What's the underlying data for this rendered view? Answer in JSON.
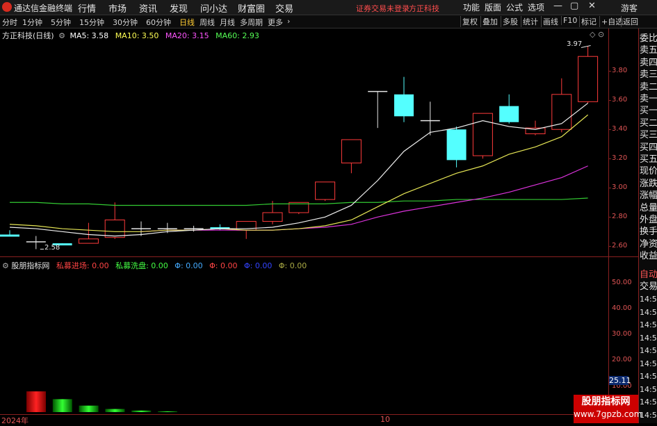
{
  "app": {
    "title": "通达信金融终端",
    "menu": [
      "行情",
      "市场",
      "资讯",
      "发现",
      "问小达",
      "财富圈",
      "交易"
    ],
    "status": "证券交易未登录",
    "stock_name": "方正科技",
    "top_right": [
      "功能",
      "版面",
      "公式",
      "选项"
    ],
    "guest": "游客"
  },
  "periods": [
    "分时",
    "1分钟",
    "5分钟",
    "15分钟",
    "30分钟",
    "60分钟",
    "日线",
    "周线",
    "月线",
    "多周期",
    "更多"
  ],
  "active_period": "日线",
  "tools": [
    "复权",
    "叠加",
    "多股",
    "统计",
    "画线",
    "F10",
    "标记",
    "+自选",
    "返回"
  ],
  "main_legend": {
    "title": "方正科技(日线)",
    "items": [
      {
        "label": "MA5: 3.58",
        "color": "#ffffff"
      },
      {
        "label": "MA10: 3.50",
        "color": "#ffff55"
      },
      {
        "label": "MA20: 3.15",
        "color": "#ff55ff"
      },
      {
        "label": "MA60: 2.93",
        "color": "#55ff55"
      }
    ]
  },
  "price_axis": [
    "3.80",
    "3.60",
    "3.40",
    "3.20",
    "3.00",
    "2.80",
    "2.60"
  ],
  "annotations": {
    "high": "3.97",
    "low": "2.58"
  },
  "indicator_legend": {
    "title": "股朋指标网",
    "items": [
      {
        "label": "私募进场: 0.00",
        "color": "#ff4444"
      },
      {
        "label": "私募洗盘: 0.00",
        "color": "#44ff44"
      },
      {
        "label": "Φ: 0.00",
        "color": "#44aaff"
      },
      {
        "label": "Φ: 0.00",
        "color": "#ff4444"
      },
      {
        "label": "Φ: 0.00",
        "color": "#3344ff"
      },
      {
        "label": "Φ: 0.00",
        "color": "#aaaa44"
      }
    ]
  },
  "indicator_axis": [
    "50.00",
    "40.00",
    "30.00",
    "20.00",
    "10.00"
  ],
  "indicator_current": "25.11",
  "date_labels": [
    "2024年",
    "10"
  ],
  "right_panel": {
    "quote_labels": [
      "委比",
      "卖五",
      "卖四",
      "卖三",
      "卖二",
      "卖一",
      "买一",
      "买二",
      "买三",
      "买四",
      "买五",
      "现价",
      "涨跌",
      "涨幅",
      "总量",
      "外盘",
      "换手",
      "净资",
      "收益"
    ],
    "mode_labels": [
      "自动",
      "交易"
    ],
    "times": [
      "14:56",
      "14:56",
      "14:56",
      "14:56",
      "14:56",
      "14:56",
      "14:56",
      "14:56",
      "14:56",
      "14:56"
    ]
  },
  "watermark": {
    "line1": "股朋指标网",
    "line2": "www.7gpzb.com"
  },
  "chart_data": {
    "type": "candlestick",
    "candles": [
      {
        "o": 2.68,
        "c": 2.68,
        "h": 2.71,
        "l": 2.68,
        "color": "cyan"
      },
      {
        "o": 2.63,
        "c": 2.63,
        "h": 2.67,
        "l": 2.58,
        "color": "white"
      },
      {
        "o": 2.61,
        "c": 2.62,
        "h": 2.62,
        "l": 2.61,
        "color": "cyan"
      },
      {
        "o": 2.62,
        "c": 2.65,
        "h": 2.76,
        "l": 2.62,
        "color": "red"
      },
      {
        "o": 2.66,
        "c": 2.78,
        "h": 2.9,
        "l": 2.65,
        "color": "red"
      },
      {
        "o": 2.72,
        "c": 2.72,
        "h": 2.77,
        "l": 2.67,
        "color": "white"
      },
      {
        "o": 2.72,
        "c": 2.72,
        "h": 2.76,
        "l": 2.69,
        "color": "white"
      },
      {
        "o": 2.72,
        "c": 2.72,
        "h": 2.74,
        "l": 2.7,
        "color": "white"
      },
      {
        "o": 2.73,
        "c": 2.72,
        "h": 2.75,
        "l": 2.71,
        "color": "cyan"
      },
      {
        "o": 2.71,
        "c": 2.77,
        "h": 2.77,
        "l": 2.65,
        "color": "red"
      },
      {
        "o": 2.77,
        "c": 2.83,
        "h": 2.91,
        "l": 2.75,
        "color": "red"
      },
      {
        "o": 2.83,
        "c": 2.9,
        "h": 2.9,
        "l": 2.82,
        "color": "red"
      },
      {
        "o": 2.92,
        "c": 3.04,
        "h": 3.04,
        "l": 2.91,
        "color": "red"
      },
      {
        "o": 3.17,
        "c": 3.33,
        "h": 3.33,
        "l": 3.1,
        "color": "red"
      },
      {
        "o": 3.66,
        "c": 3.66,
        "h": 3.66,
        "l": 3.41,
        "color": "white"
      },
      {
        "o": 3.64,
        "c": 3.49,
        "h": 3.76,
        "l": 3.45,
        "color": "cyan"
      },
      {
        "o": 3.46,
        "c": 3.46,
        "h": 3.59,
        "l": 3.36,
        "color": "white"
      },
      {
        "o": 3.4,
        "c": 3.19,
        "h": 3.42,
        "l": 3.14,
        "color": "cyan"
      },
      {
        "o": 3.22,
        "c": 3.51,
        "h": 3.51,
        "l": 3.2,
        "color": "red"
      },
      {
        "o": 3.56,
        "c": 3.45,
        "h": 3.64,
        "l": 3.44,
        "color": "cyan"
      },
      {
        "o": 3.37,
        "c": 3.41,
        "h": 3.46,
        "l": 3.36,
        "color": "red"
      },
      {
        "o": 3.4,
        "c": 3.64,
        "h": 3.75,
        "l": 3.38,
        "color": "red"
      },
      {
        "o": 3.59,
        "c": 3.9,
        "h": 3.97,
        "l": 3.58,
        "color": "red"
      }
    ],
    "ma5": [
      2.73,
      2.72,
      2.7,
      2.68,
      2.67,
      2.68,
      2.7,
      2.71,
      2.72,
      2.72,
      2.73,
      2.76,
      2.8,
      2.88,
      3.05,
      3.25,
      3.38,
      3.41,
      3.46,
      3.42,
      3.4,
      3.44,
      3.58
    ],
    "ma10": [
      2.75,
      2.74,
      2.72,
      2.71,
      2.7,
      2.7,
      2.71,
      2.71,
      2.72,
      2.71,
      2.71,
      2.72,
      2.74,
      2.78,
      2.87,
      2.96,
      3.03,
      3.1,
      3.15,
      3.23,
      3.28,
      3.35,
      3.5
    ],
    "ma20": [
      null,
      null,
      null,
      null,
      null,
      2.7,
      2.71,
      2.71,
      2.71,
      2.71,
      2.71,
      2.72,
      2.73,
      2.75,
      2.8,
      2.84,
      2.87,
      2.9,
      2.93,
      2.97,
      3.02,
      3.07,
      3.15
    ],
    "ma60": [
      2.9,
      2.9,
      2.89,
      2.89,
      2.88,
      2.88,
      2.88,
      2.88,
      2.88,
      2.88,
      2.89,
      2.89,
      2.89,
      2.9,
      2.9,
      2.91,
      2.91,
      2.92,
      2.92,
      2.92,
      2.92,
      2.92,
      2.93
    ],
    "indicator_bars": [
      {
        "value": 8.0,
        "color": "red"
      },
      {
        "value": 5.0,
        "color": "green"
      },
      {
        "value": 2.5,
        "color": "green"
      },
      {
        "value": 1.2,
        "color": "green"
      },
      {
        "value": 0.6,
        "color": "green"
      },
      {
        "value": 0.3,
        "color": "green"
      }
    ],
    "price_range": [
      2.53,
      4.02
    ],
    "indicator_range": [
      0,
      55
    ]
  }
}
